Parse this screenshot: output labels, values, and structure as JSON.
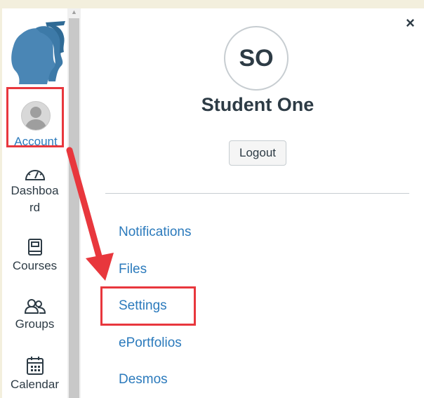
{
  "nav": {
    "account_label": "Account",
    "dashboard_label": "Dashboa rd",
    "courses_label": "Courses",
    "groups_label": "Groups",
    "calendar_label": "Calendar"
  },
  "tray": {
    "initials": "SO",
    "user_name": "Student One",
    "logout_label": "Logout",
    "close_symbol": "×",
    "links": [
      "Notifications",
      "Files",
      "Settings",
      "ePortfolios",
      "Desmos"
    ]
  },
  "colors": {
    "accent": "#2b7abc",
    "highlight": "#e8373d",
    "text": "#2d3b45"
  }
}
